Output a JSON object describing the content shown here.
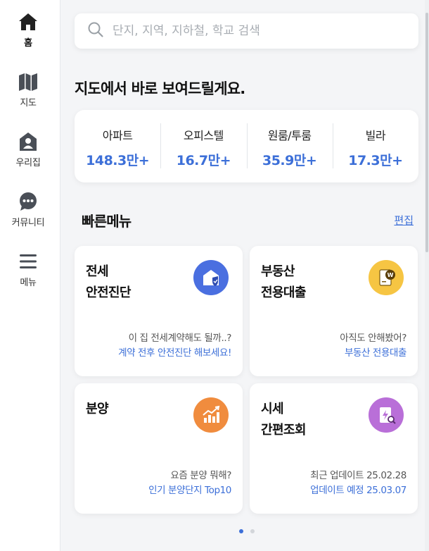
{
  "sidebar": {
    "items": [
      {
        "label": "홈",
        "icon": "home-icon",
        "active": true
      },
      {
        "label": "지도",
        "icon": "map-icon"
      },
      {
        "label": "우리집",
        "icon": "my-home-icon"
      },
      {
        "label": "커뮤니티",
        "icon": "chat-bubble-icon"
      },
      {
        "label": "메뉴",
        "icon": "hamburger-menu-icon"
      }
    ]
  },
  "search": {
    "placeholder": "단지, 지역, 지하철, 학교 검색"
  },
  "map_section": {
    "title": "지도에서 바로 보여드릴게요.",
    "stats": [
      {
        "label": "아파트",
        "value": "148.3만+"
      },
      {
        "label": "오피스텔",
        "value": "16.7만+"
      },
      {
        "label": "원룸/투룸",
        "value": "35.9만+"
      },
      {
        "label": "빌라",
        "value": "17.3만+"
      }
    ]
  },
  "quick_menu": {
    "title": "빠른메뉴",
    "edit_label": "편집",
    "cards": [
      {
        "title_line1": "전세",
        "title_line2": "안전진단",
        "desc1": "이 집 전세계약해도 될까..?",
        "desc2": "계약 전후 안전진단 해보세요!",
        "icon": "shield-house-icon",
        "icon_color": "#4a6fe0"
      },
      {
        "title_line1": "부동산",
        "title_line2": "전용대출",
        "desc1": "아직도 안해봤어?",
        "desc2": "부동산 전용대출",
        "icon": "loan-document-icon",
        "icon_color": "#f6c543"
      },
      {
        "title_line1": "분양",
        "title_line2": "",
        "desc1": "요즘 분양 뭐해?",
        "desc2": "인기 분양단지 Top10",
        "icon": "rising-chart-icon",
        "icon_color": "#f08c3e"
      },
      {
        "title_line1": "시세",
        "title_line2": "간편조회",
        "desc1": "최근 업데이트 25.02.28",
        "desc2": "업데이트 예정 25.03.07",
        "icon": "price-search-icon",
        "icon_color": "#b96fd8"
      }
    ]
  },
  "pagination": {
    "current": 1,
    "total": 2
  }
}
